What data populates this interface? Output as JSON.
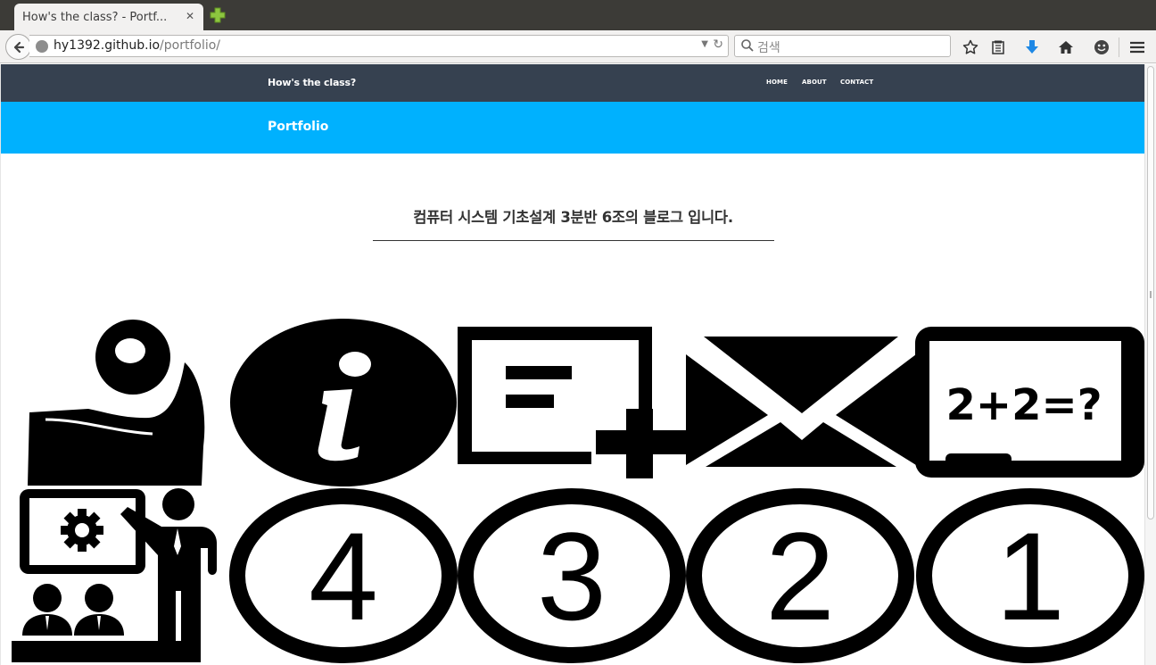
{
  "browser": {
    "tab_title": "How's the class? - Portf...",
    "url_host": "hy1392.github.io",
    "url_path": "/portfolio/",
    "search_placeholder": "검색"
  },
  "site": {
    "brand": "How's the class?",
    "nav": [
      "HOME",
      "ABOUT",
      "CONTACT"
    ],
    "hero_title": "Portfolio",
    "intro": "컴퓨터 시스템 기초설계 3분반 6조의 블로그 입니다."
  },
  "tiles": {
    "math_board_text": "2+2=?",
    "numbers": [
      "4",
      "3",
      "2",
      "1"
    ]
  }
}
